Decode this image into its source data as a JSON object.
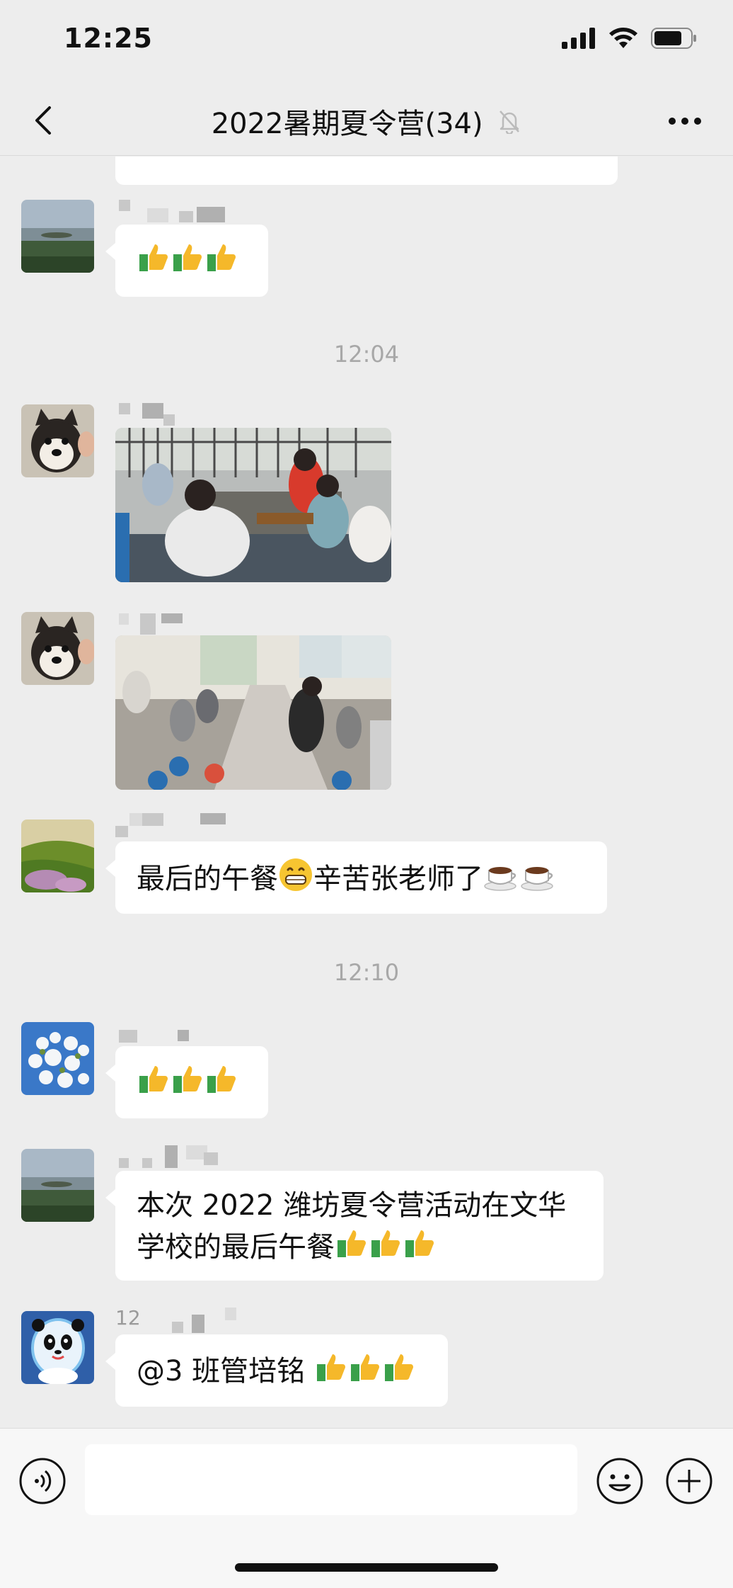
{
  "status_bar": {
    "time": "12:25"
  },
  "nav": {
    "title": "2022暑期夏令营(34)"
  },
  "messages": {
    "m1": {
      "text": ""
    },
    "time1": "12:04",
    "m4_text": "最后的午餐",
    "m4_text2": "辛苦张老师了",
    "time2": "12:10",
    "m6_line1": "本次 2022 潍坊夏令营活动在文华",
    "m6_line2": "学校的最后午餐",
    "m7_nick_prefix": "12",
    "m7_text": "@3 班管培铭 "
  },
  "colors": {
    "background": "#ededed",
    "bubble": "#ffffff",
    "time_label": "#a8a8a8"
  },
  "icons": [
    "back-icon",
    "mute-bell-icon",
    "more-icon",
    "voice-icon",
    "emoji-icon",
    "plus-icon",
    "thumbs-up-emoji",
    "grin-emoji",
    "coffee-emoji"
  ]
}
